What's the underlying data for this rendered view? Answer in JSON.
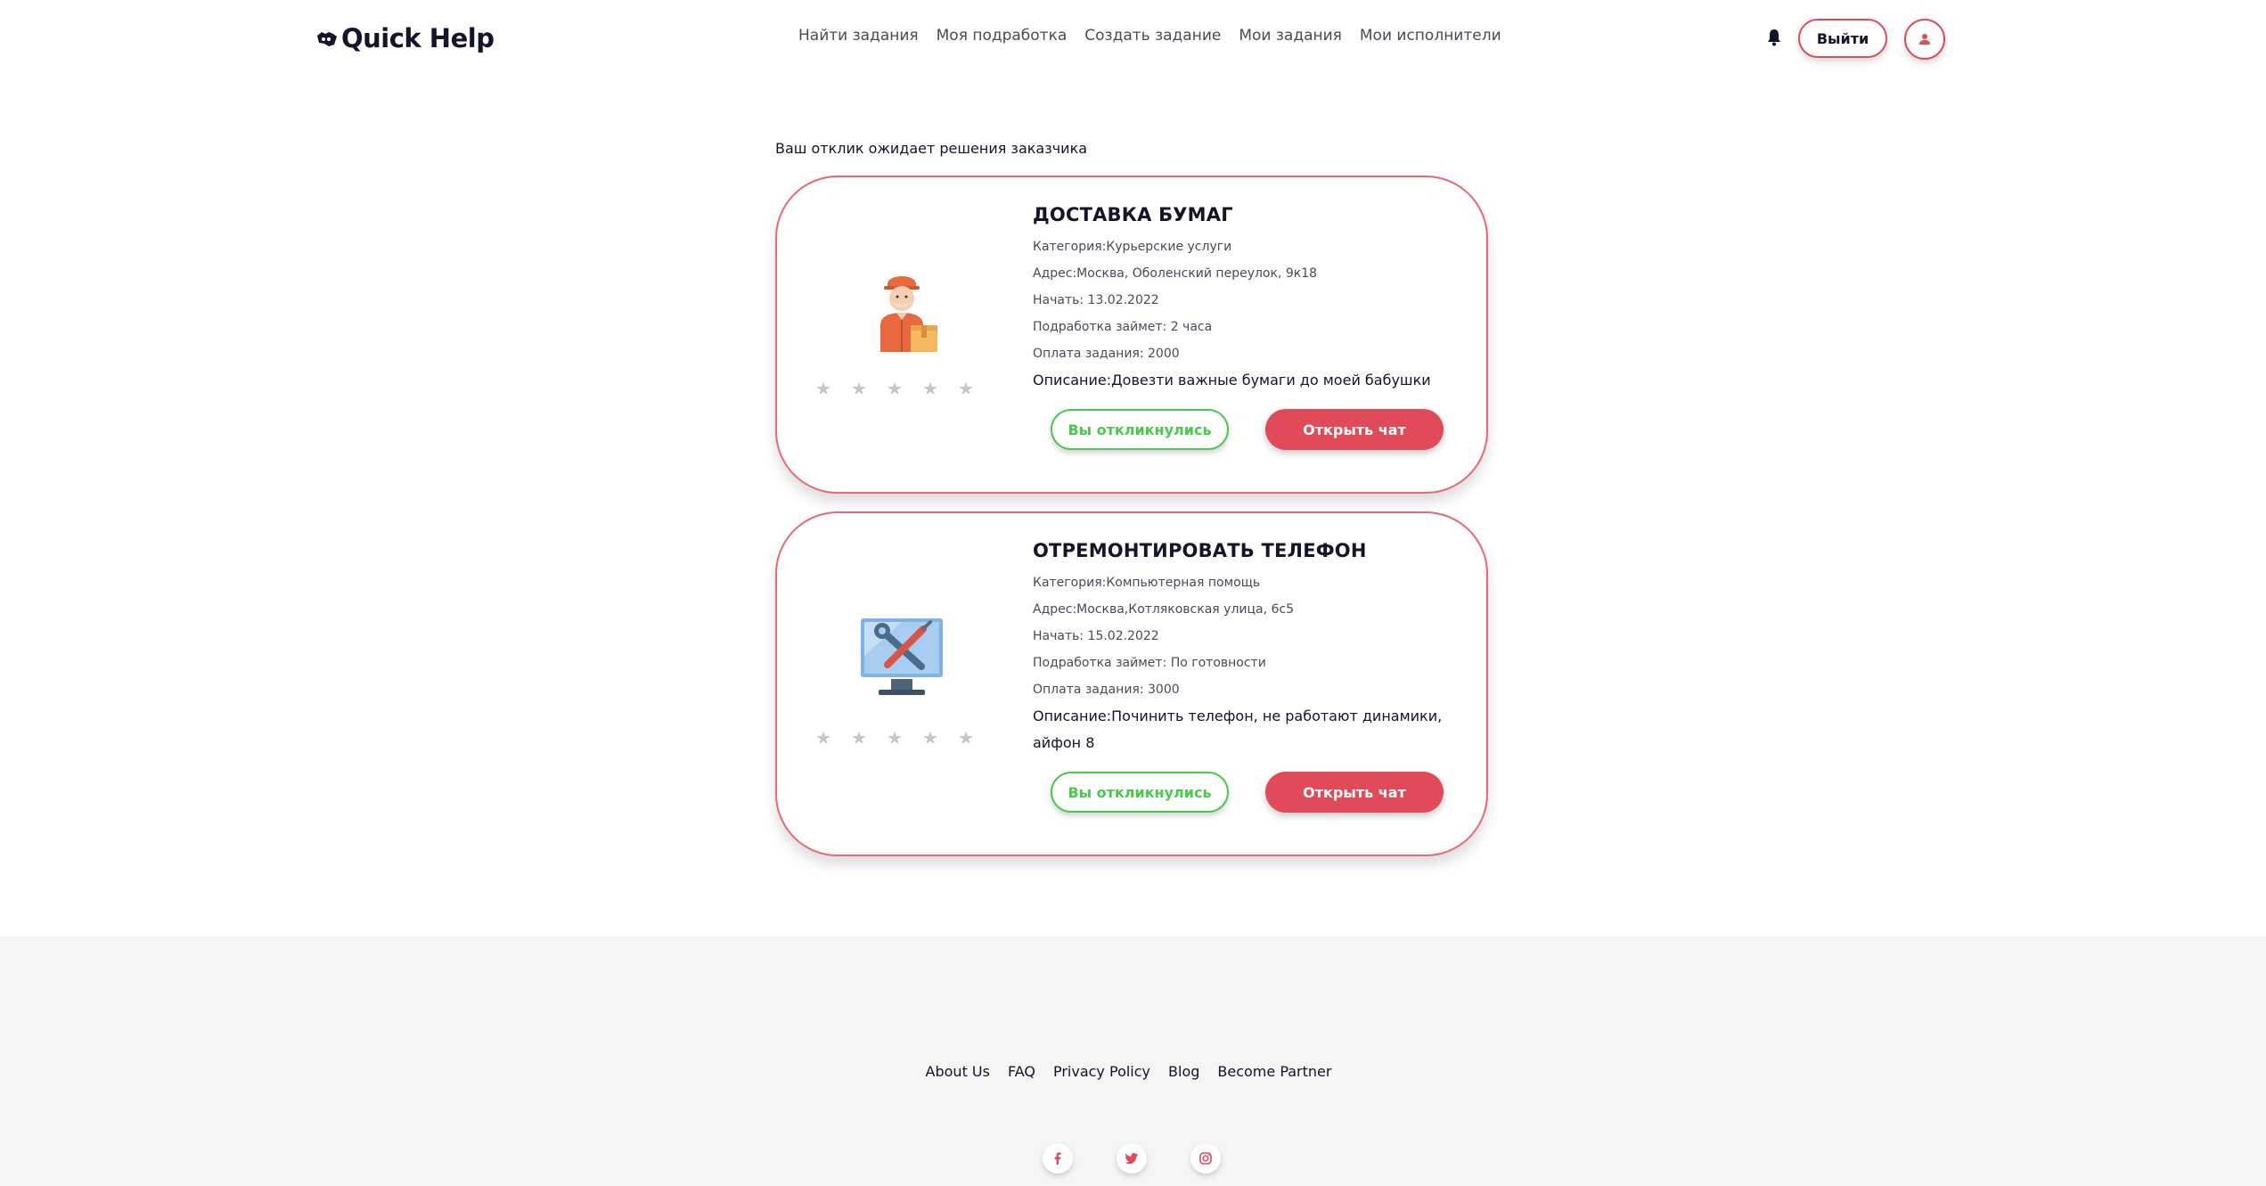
{
  "header": {
    "logo_text": "Quick Help",
    "nav": [
      {
        "label": "Найти задания"
      },
      {
        "label": "Моя подработка"
      },
      {
        "label": "Создать задание"
      },
      {
        "label": "Мои задания"
      },
      {
        "label": "Мои исполнители"
      }
    ],
    "logout_label": "Выйти",
    "icons": {
      "logo": "handshake-icon",
      "bell": "bell-icon",
      "avatar": "user-icon"
    }
  },
  "main": {
    "status_text": "Ваш отклик ожидает решения заказчика",
    "cards": [
      {
        "title": "ДОСТАВКА БУМАГ",
        "category": "Категория:Курьерские услуги",
        "address": "Адрес:Москва, Оболенский переулок, 9к18",
        "start": "Начать: 13.02.2022",
        "duration": "Подработка займет: 2 часа",
        "payment": "Оплата задания: 2000",
        "description": "Описание:Довезти важные бумаги до моей бабушки",
        "responded_label": "Вы откликнулись",
        "chat_label": "Открыть чат",
        "image": "courier-icon",
        "rating": 0
      },
      {
        "title": "ОТРЕМОНТИРОВАТЬ ТЕЛЕФОН",
        "category": "Категория:Компьютерная помощь",
        "address": "Адрес:Москва,Котляковская улица, 6с5",
        "start": "Начать: 15.02.2022",
        "duration": "Подработка займет: По готовности",
        "payment": "Оплата задания: 3000",
        "description": "Описание:Починить телефон, не работают динамики, айфон 8",
        "responded_label": "Вы откликнулись",
        "chat_label": "Открыть чат",
        "image": "computer-repair-icon",
        "rating": 0
      }
    ]
  },
  "footer": {
    "links": [
      {
        "label": "About Us"
      },
      {
        "label": "FAQ"
      },
      {
        "label": "Privacy Policy"
      },
      {
        "label": "Blog"
      },
      {
        "label": "Become Partner"
      }
    ],
    "social": [
      {
        "icon": "facebook-icon",
        "glyph": "f"
      },
      {
        "icon": "twitter-icon",
        "glyph": "t"
      },
      {
        "icon": "instagram-icon",
        "glyph": "◎"
      }
    ]
  },
  "colors": {
    "accent": "#e04a59",
    "success": "#4bc94b",
    "card_border": "#e66a76",
    "footer_bg": "#f5f5f5",
    "text_dark": "#14142b"
  }
}
